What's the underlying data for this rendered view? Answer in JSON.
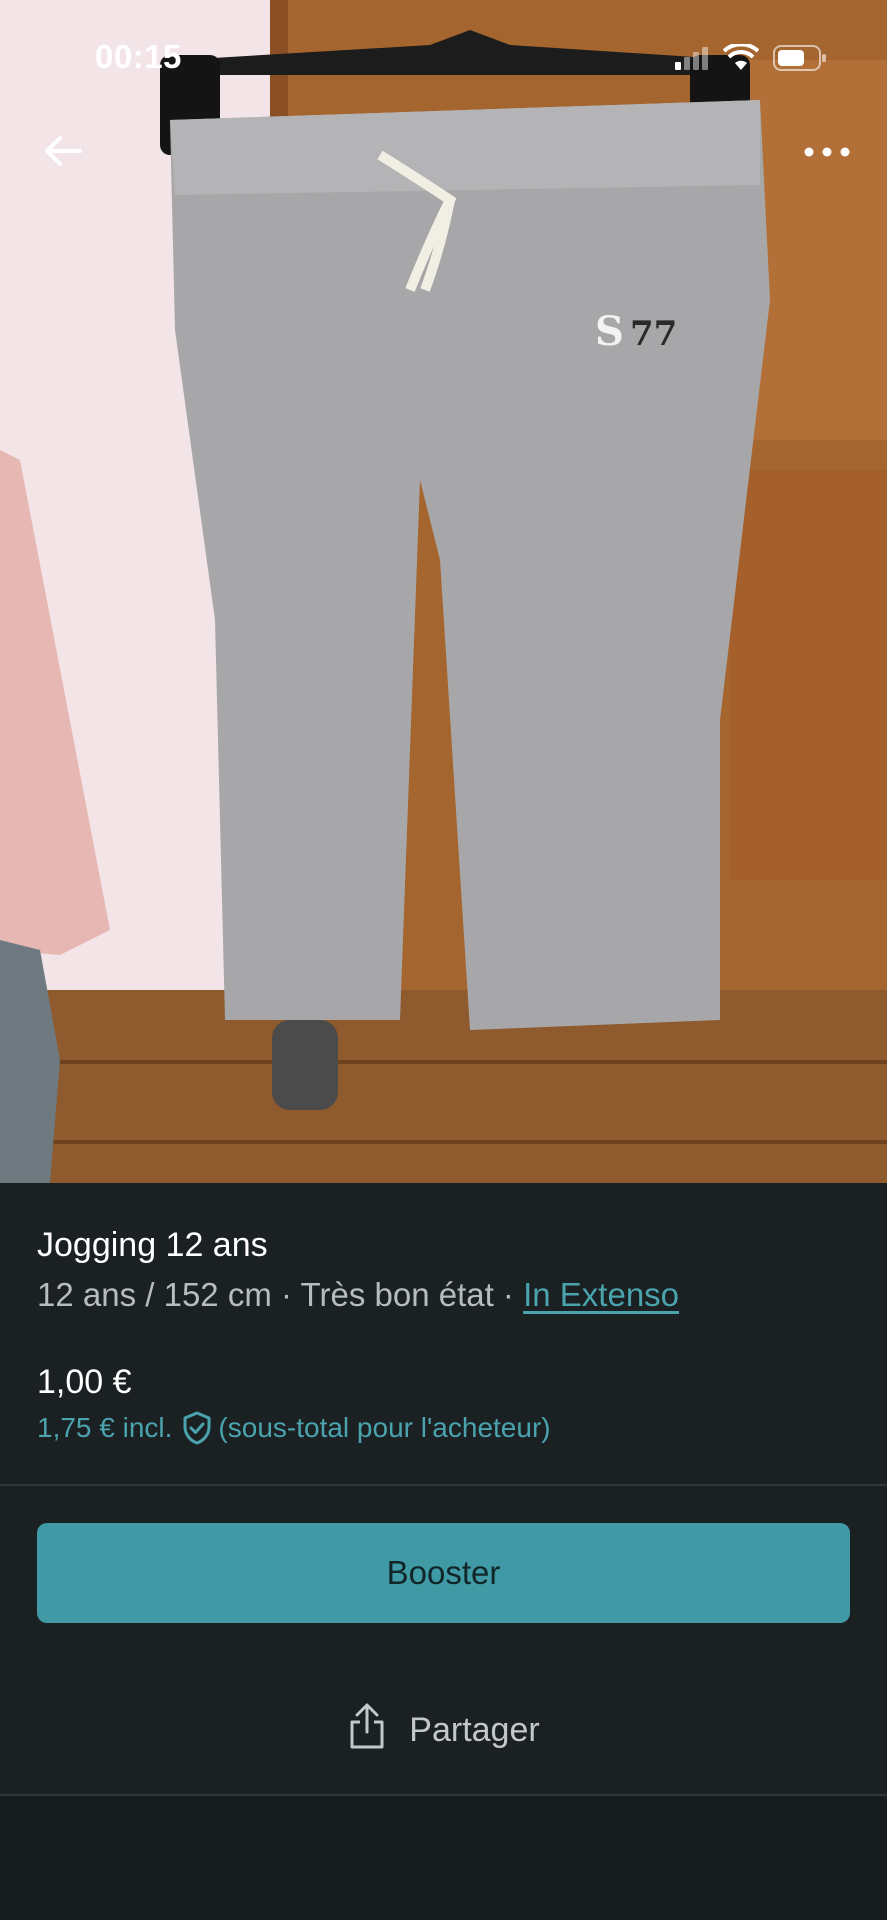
{
  "status_bar": {
    "time": "00:15"
  },
  "nav": {
    "back_icon": "arrow-left-icon",
    "more_icon": "more-dots-icon"
  },
  "item": {
    "title": "Jogging 12 ans",
    "size": "12 ans / 152 cm",
    "separator": " · ",
    "condition": "Très bon état",
    "brand": "In Extenso",
    "price": "1,00 €",
    "price_incl": "1,75 € incl.",
    "price_incl_note": "(sous-total pour l'acheteur)"
  },
  "actions": {
    "booster_label": "Booster",
    "share_label": "Partager"
  },
  "colors": {
    "accent": "#4aa3ad",
    "button": "#3f9aa6",
    "background": "#1b2023"
  }
}
